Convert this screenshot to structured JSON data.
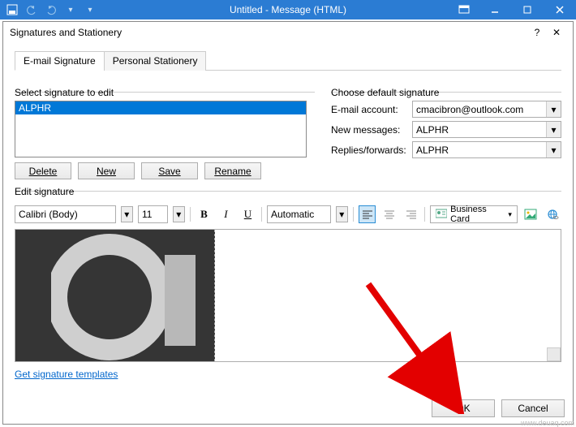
{
  "ribbon": {
    "title": "Untitled  -  Message (HTML)"
  },
  "dialog": {
    "title": "Signatures and Stationery",
    "help": "?",
    "close": "✕"
  },
  "tabs": {
    "email": "E-mail Signature",
    "personal": "Personal Stationery"
  },
  "select_group": {
    "legend": "Select signature to edit",
    "selected_item": "ALPHR",
    "delete": "Delete",
    "new": "New",
    "save": "Save",
    "rename": "Rename"
  },
  "choose_group": {
    "legend": "Choose default signature",
    "email_label": "E-mail account:",
    "email_value": "cmacibron@outlook.com",
    "new_label": "New messages:",
    "new_value": "ALPHR",
    "replies_label": "Replies/forwards:",
    "replies_value": "ALPHR"
  },
  "edit_group": {
    "legend": "Edit signature",
    "font": "Calibri (Body)",
    "size": "11",
    "bold": "B",
    "italic": "I",
    "underline": "U",
    "auto": "Automatic",
    "bcard": "Business Card"
  },
  "link": "Get signature templates",
  "footer": {
    "ok": "OK",
    "cancel": "Cancel"
  },
  "watermark": "www.deuaq.com"
}
